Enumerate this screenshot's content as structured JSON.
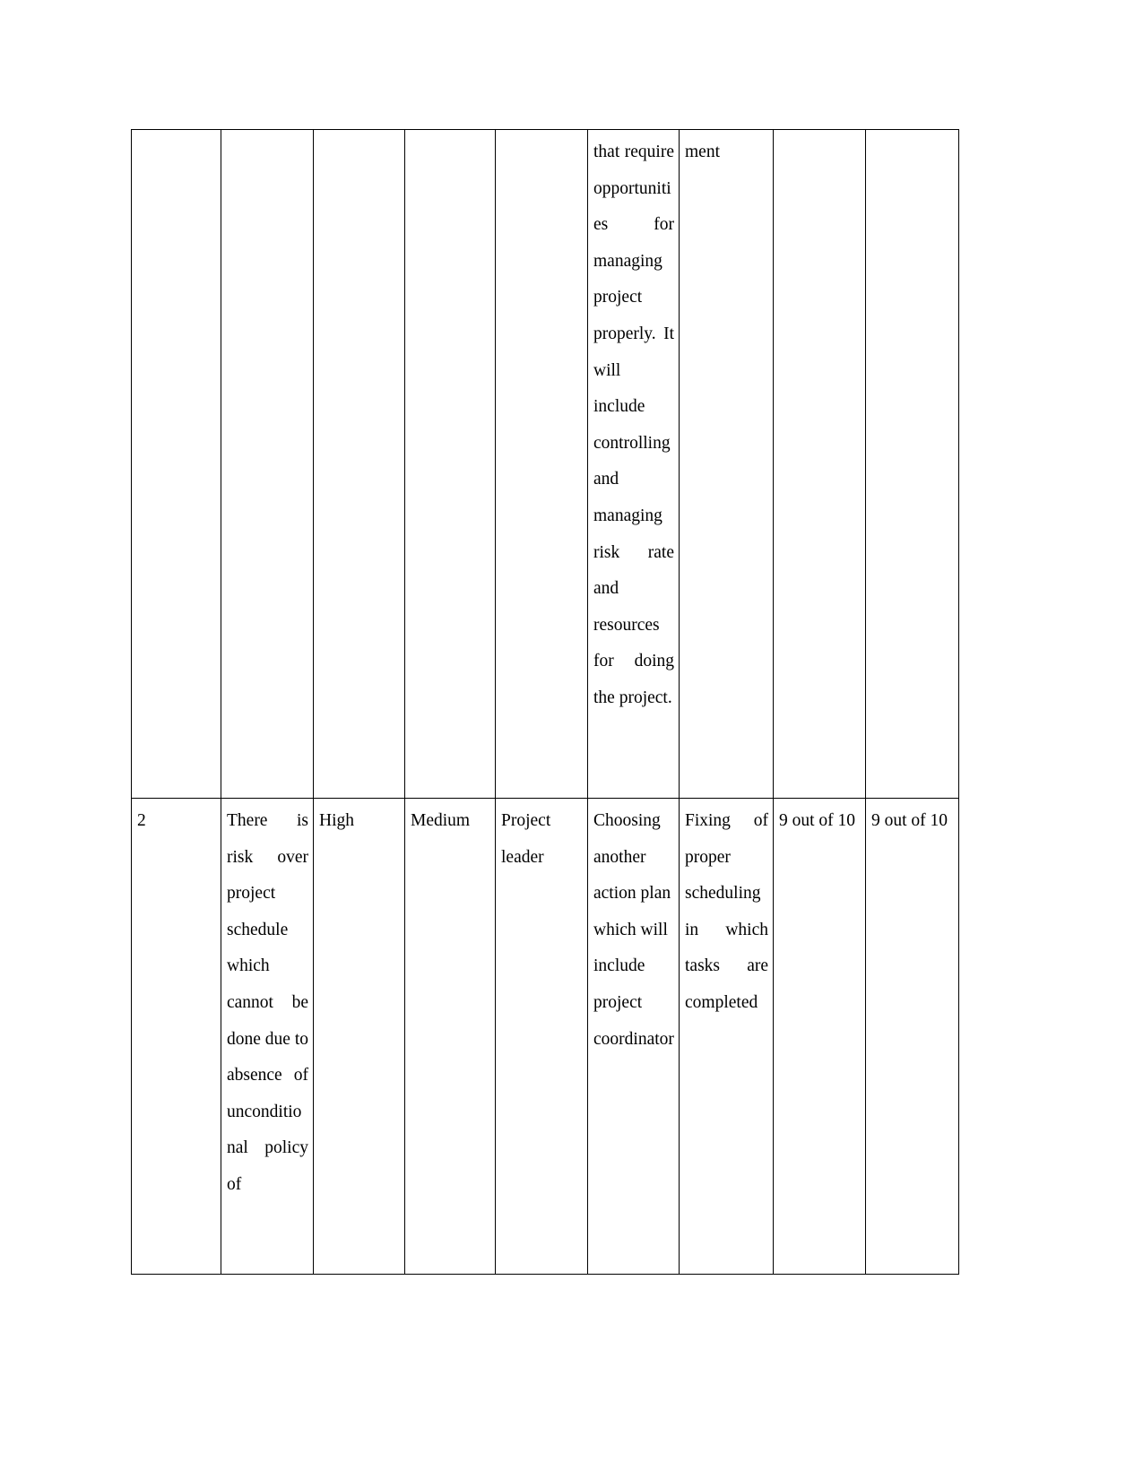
{
  "document": {
    "type": "risk-register-table",
    "page_background": "#ffffff",
    "text_color": "#000000",
    "border_color": "#000000",
    "continued_from_previous_page": true
  },
  "table": {
    "column_count": 9,
    "row_count": 2,
    "columns": [
      {
        "key": "sr_no"
      },
      {
        "key": "risk_description"
      },
      {
        "key": "impact"
      },
      {
        "key": "likelihood"
      },
      {
        "key": "owner"
      },
      {
        "key": "contingency_plan"
      },
      {
        "key": "mitigation_action"
      },
      {
        "key": "rating_before"
      },
      {
        "key": "rating_after"
      }
    ],
    "rows": [
      {
        "name": "row-continued",
        "continued": true,
        "cells": {
          "sr_no": "",
          "risk_description": "",
          "impact": "",
          "likelihood": "",
          "owner": "",
          "contingency_plan": "that require opportunities for managing project properly. It will include controlling and managing risk rate and resources for doing the project.",
          "mitigation_action": "ment",
          "rating_before": "",
          "rating_after": ""
        }
      },
      {
        "name": "row-two",
        "continued": false,
        "cells": {
          "sr_no": "2",
          "risk_description": "There is risk over project schedule which cannot be done due to absence of unconditional policy of",
          "impact": "High",
          "likelihood": "Medium",
          "owner": "Project leader",
          "contingency_plan": "Choosing another action plan which will include project coordinator",
          "mitigation_action": "Fixing of proper scheduling in which tasks are completed",
          "rating_before": "9 out of 10",
          "rating_after": "9 out of 10"
        }
      }
    ]
  }
}
